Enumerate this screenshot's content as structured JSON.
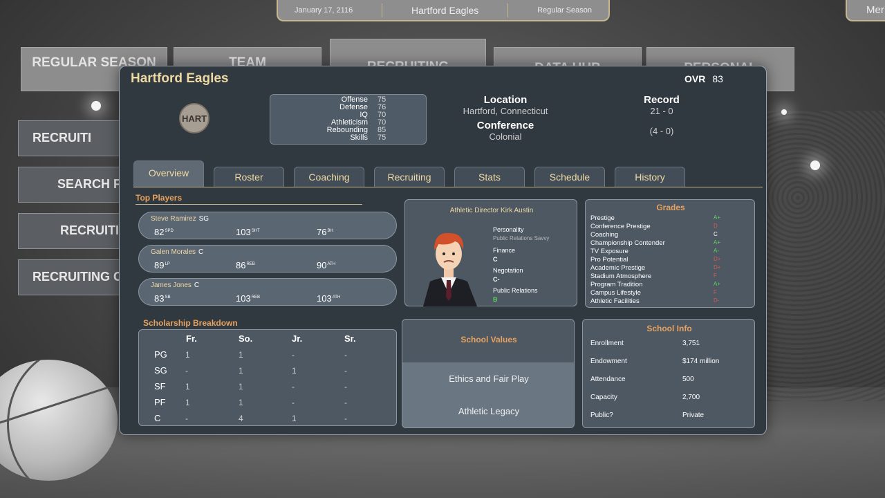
{
  "topbar": {
    "date": "January 17, 2116",
    "team": "Hartford Eagles",
    "phase": "Regular Season",
    "menu": "Mer"
  },
  "nav_tiles": [
    "REGULAR SEASON",
    "TEAM",
    "RECRUITING",
    "DATA HUB",
    "PERSONAL"
  ],
  "side_buttons": [
    "RECRUITI",
    "SEARCH F",
    "RECRUITI",
    "RECRUITING C"
  ],
  "school": {
    "name": "Hartford Eagles",
    "ovr_label": "OVR",
    "ovr_value": "83",
    "logo_text": "HART",
    "ratings": [
      {
        "label": "Offense",
        "value": "75"
      },
      {
        "label": "Defense",
        "value": "76"
      },
      {
        "label": "IQ",
        "value": "70"
      },
      {
        "label": "Athleticism",
        "value": "70"
      },
      {
        "label": "Rebounding",
        "value": "85"
      },
      {
        "label": "Skills",
        "value": "75"
      }
    ],
    "location_label": "Location",
    "location": "Hartford, Connecticut",
    "conference_label": "Conference",
    "conference": "Colonial",
    "record_label": "Record",
    "record": "21 - 0",
    "conf_record": "(4 - 0)"
  },
  "tabs": [
    "Overview",
    "Roster",
    "Coaching",
    "Recruiting",
    "Stats",
    "Schedule",
    "History"
  ],
  "top_players": {
    "title": "Top Players",
    "players": [
      {
        "name": "Steve Ramirez",
        "pos": "SG",
        "stats": [
          {
            "v": "82",
            "k": "SPD"
          },
          {
            "v": "103",
            "k": "SHT"
          },
          {
            "v": "76",
            "k": "BH"
          }
        ]
      },
      {
        "name": "Galen Morales",
        "pos": "C",
        "stats": [
          {
            "v": "89",
            "k": "LP"
          },
          {
            "v": "86",
            "k": "REB"
          },
          {
            "v": "90",
            "k": "ATH"
          }
        ]
      },
      {
        "name": "James Jones",
        "pos": "C",
        "stats": [
          {
            "v": "83",
            "k": "SB"
          },
          {
            "v": "103",
            "k": "REB"
          },
          {
            "v": "103",
            "k": "ATH"
          }
        ]
      }
    ]
  },
  "athletic_director": {
    "title": "Athletic Director Kirk Austin",
    "personality_label": "Personality",
    "personality": "Public Relations Savvy",
    "finance_label": "Finance",
    "finance": "C",
    "negotiation_label": "Negotation",
    "negotiation": "C-",
    "pr_label": "Public Relations",
    "pr": "B"
  },
  "grades": {
    "title": "Grades",
    "items": [
      {
        "label": "Prestige",
        "grade": "A+",
        "color": "#5fd35f"
      },
      {
        "label": "Conference Prestige",
        "grade": "D",
        "color": "#e05555"
      },
      {
        "label": "Coaching",
        "grade": "C",
        "color": "#ffffff"
      },
      {
        "label": "Championship Contender",
        "grade": "A+",
        "color": "#5fd35f"
      },
      {
        "label": "TV Exposure",
        "grade": "A-",
        "color": "#5fd35f"
      },
      {
        "label": "Pro Potential",
        "grade": "D+",
        "color": "#e05555"
      },
      {
        "label": "Academic Prestige",
        "grade": "D+",
        "color": "#e05555"
      },
      {
        "label": "Stadium Atmosphere",
        "grade": "F",
        "color": "#e05555"
      },
      {
        "label": "Program Tradition",
        "grade": "A+",
        "color": "#5fd35f"
      },
      {
        "label": "Campus Lifestyle",
        "grade": "F",
        "color": "#e05555"
      },
      {
        "label": "Athletic Facilities",
        "grade": "D-",
        "color": "#e05555"
      }
    ]
  },
  "scholarship": {
    "title": "Scholarship Breakdown",
    "columns": [
      "Fr.",
      "So.",
      "Jr.",
      "Sr."
    ],
    "rows": [
      {
        "pos": "PG",
        "vals": [
          "1",
          "1",
          "-",
          "-"
        ]
      },
      {
        "pos": "SG",
        "vals": [
          "-",
          "1",
          "1",
          "-"
        ]
      },
      {
        "pos": "SF",
        "vals": [
          "1",
          "1",
          "-",
          "-"
        ]
      },
      {
        "pos": "PF",
        "vals": [
          "1",
          "1",
          "-",
          "-"
        ]
      },
      {
        "pos": "C",
        "vals": [
          "-",
          "4",
          "1",
          "-"
        ]
      }
    ]
  },
  "school_values": {
    "title": "School Values",
    "items": [
      "Ethics and Fair Play",
      "Athletic Legacy"
    ]
  },
  "school_info": {
    "title": "School Info",
    "items": [
      {
        "label": "Enrollment",
        "value": "3,751"
      },
      {
        "label": "Endowment",
        "value": "$174 million"
      },
      {
        "label": "Attendance",
        "value": "500"
      },
      {
        "label": "Capacity",
        "value": "2,700"
      },
      {
        "label": "Public?",
        "value": "Private"
      }
    ]
  }
}
